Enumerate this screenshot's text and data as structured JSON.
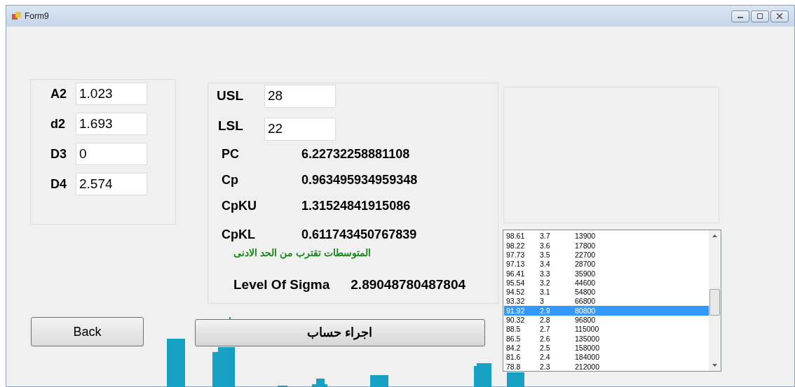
{
  "window": {
    "title": "Form9"
  },
  "constants": [
    {
      "label": "A2",
      "value": "1.023"
    },
    {
      "label": "d2",
      "value": "1.693"
    },
    {
      "label": "D3",
      "value": "0"
    },
    {
      "label": "D4",
      "value": "2.574"
    }
  ],
  "limits": [
    {
      "label": "USL",
      "value": "28"
    },
    {
      "label": "LSL",
      "value": "22"
    }
  ],
  "results": [
    {
      "label": "PC",
      "value": "6.22732258881108"
    },
    {
      "label": "Cp",
      "value": "0.963495934959348"
    },
    {
      "label": "CpKU",
      "value": "1.31524841915086"
    },
    {
      "label": "CpKL",
      "value": "0.611743450767839"
    }
  ],
  "message": "المتوسطات تقترب من الحد الادنى",
  "sigma": {
    "label": "Level Of Sigma",
    "value": "2.89048780487804"
  },
  "sigma_table": [
    {
      "cells": [
        "98.61",
        "3.7",
        "13900"
      ],
      "selected": false
    },
    {
      "cells": [
        "98.22",
        "3.6",
        "17800"
      ],
      "selected": false
    },
    {
      "cells": [
        "97.73",
        "3.5",
        "22700"
      ],
      "selected": false
    },
    {
      "cells": [
        "97.13",
        "3.4",
        "28700"
      ],
      "selected": false
    },
    {
      "cells": [
        "96.41",
        "3.3",
        "35900"
      ],
      "selected": false
    },
    {
      "cells": [
        "95.54",
        "3.2",
        "44600"
      ],
      "selected": false
    },
    {
      "cells": [
        "94.52",
        "3.1",
        "54800"
      ],
      "selected": false
    },
    {
      "cells": [
        "93.32",
        "3",
        "66800"
      ],
      "selected": false
    },
    {
      "cells": [
        "91.92",
        "2.9",
        "80800"
      ],
      "selected": true
    },
    {
      "cells": [
        "90.32",
        "2.8",
        "96800"
      ],
      "selected": false
    },
    {
      "cells": [
        "88.5",
        "2.7",
        "115000"
      ],
      "selected": false
    },
    {
      "cells": [
        "86.5",
        "2.6",
        "135000"
      ],
      "selected": false
    },
    {
      "cells": [
        "84.2",
        "2.5",
        "158000"
      ],
      "selected": false
    },
    {
      "cells": [
        "81.6",
        "2.4",
        "184000"
      ],
      "selected": false
    },
    {
      "cells": [
        "78.8",
        "2.3",
        "212000"
      ],
      "selected": false
    }
  ],
  "buttons": {
    "back": "Back",
    "calculate": "اجراء حساب"
  }
}
